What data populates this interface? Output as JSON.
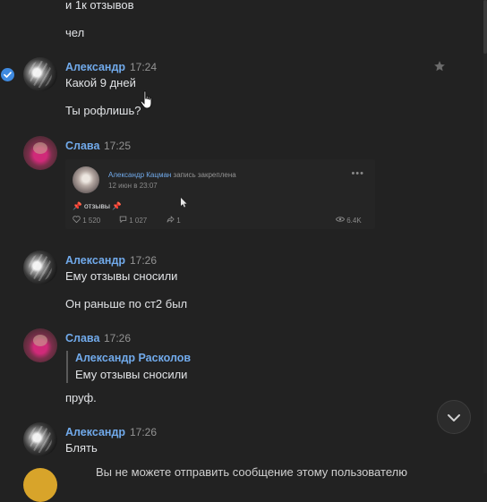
{
  "messages": {
    "m1_line1": "и 1к отзывов",
    "m1_line2": "чел",
    "g1": {
      "author": "Александр",
      "time": "17:24",
      "line1": "Какой 9 дней",
      "line2": "Ты рофлишь?"
    },
    "g2": {
      "author": "Слава",
      "time": "17:25",
      "post": {
        "author": "Александр Кацман",
        "action": "запись закреплена",
        "date": "12 июн в 23:07",
        "dots": "•••",
        "text": "📌 отзывы 📌",
        "likes": "1 520",
        "comments": "1 027",
        "shares": "1",
        "views": "6.4K"
      }
    },
    "g3": {
      "author": "Александр",
      "time": "17:26",
      "line1": "Ему отзывы сносили",
      "line2": "Он раньше по ст2 был"
    },
    "g4": {
      "author": "Слава",
      "time": "17:26",
      "quote_author": "Александр Расколов",
      "quote_text": "Ему отзывы сносили",
      "line1": "пруф."
    },
    "g5": {
      "author": "Александр",
      "time": "17:26",
      "line1": "Блять"
    }
  },
  "footer": {
    "notice": "Вы не можете отправить сообщение этому пользователю"
  },
  "icons": {
    "check": "check-circle-icon",
    "star": "star-icon",
    "scroll_down": "chevron-down-icon",
    "cursor": "hand-pointer-icon"
  },
  "colors": {
    "background": "#222222",
    "accent": "#71aaeb",
    "text": "#e1e3e6",
    "muted": "#939393",
    "check": "#3f8ae0"
  }
}
